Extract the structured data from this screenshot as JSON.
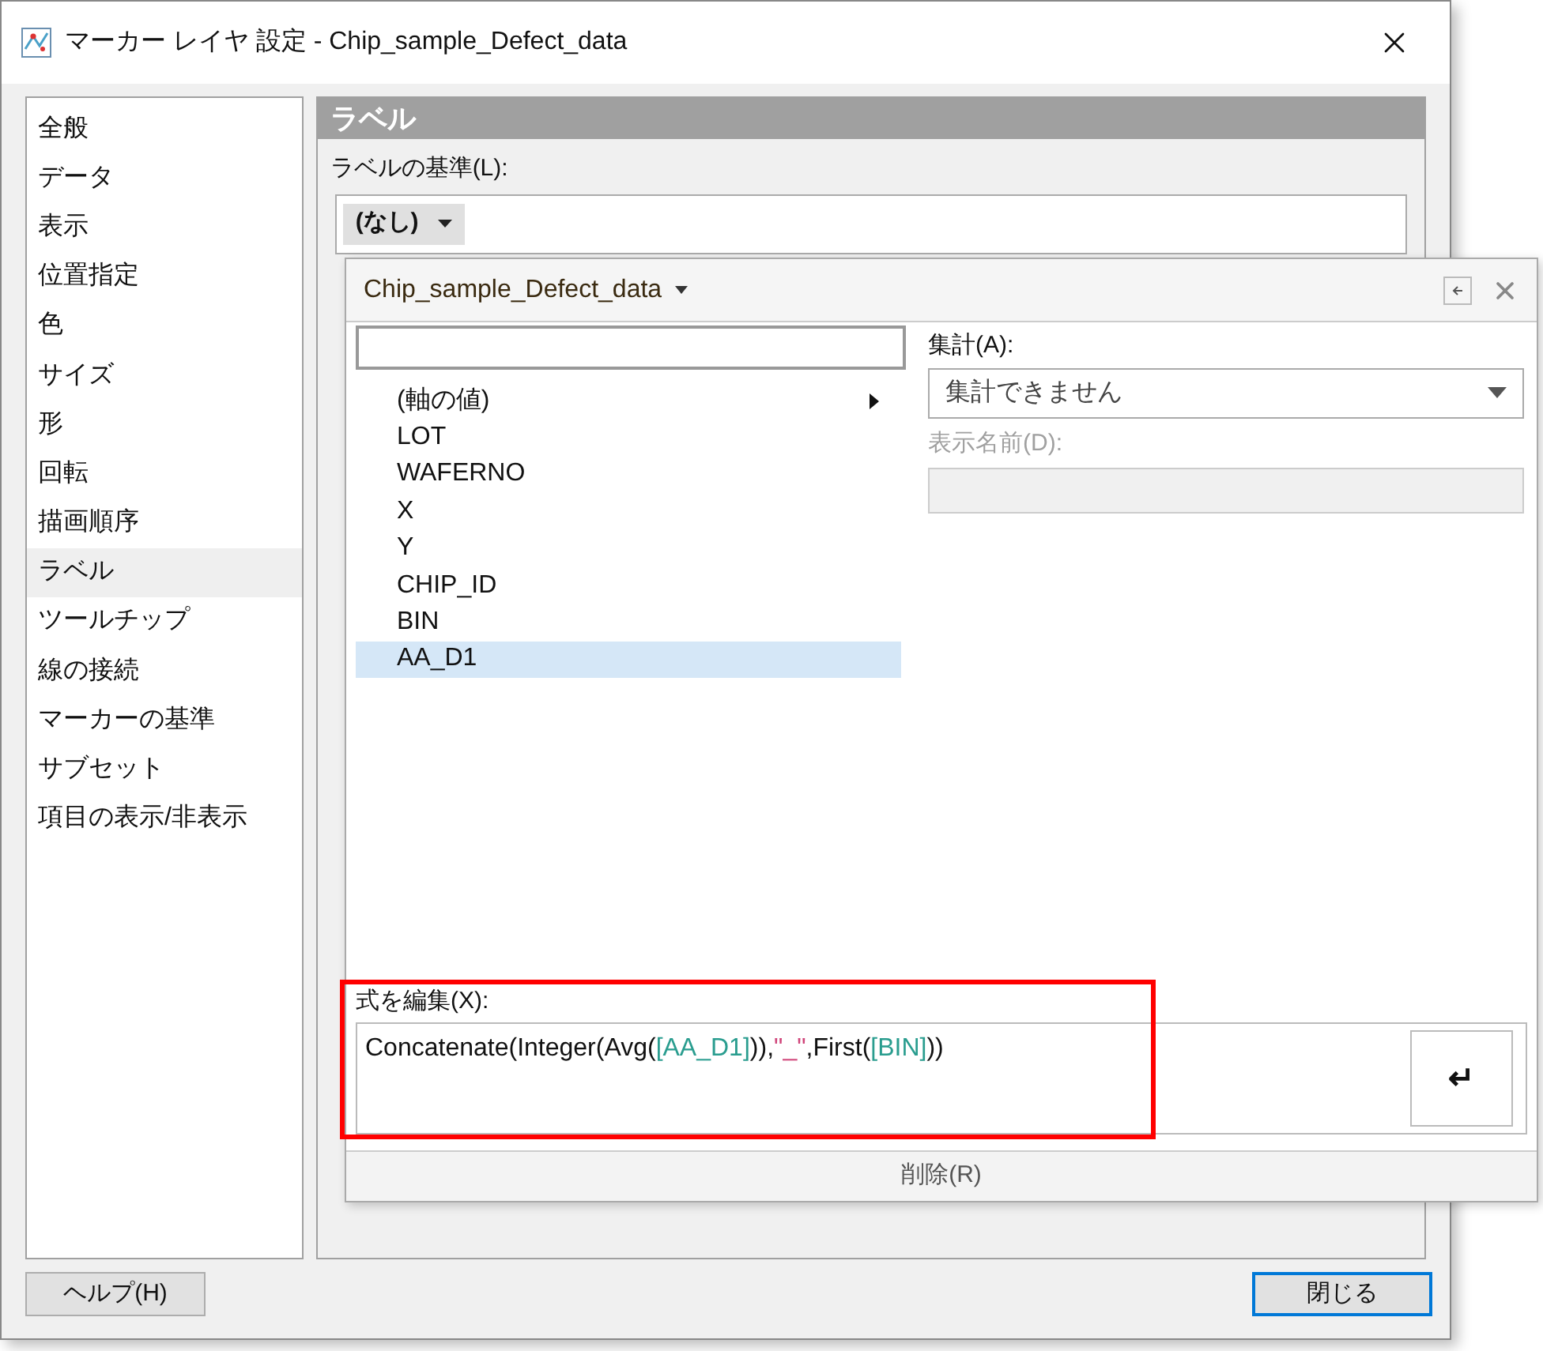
{
  "window": {
    "title": "マーカー レイヤ 設定 - Chip_sample_Defect_data"
  },
  "sidebar": {
    "items": [
      {
        "label": "全般",
        "selected": false
      },
      {
        "label": "データ",
        "selected": false
      },
      {
        "label": "表示",
        "selected": false
      },
      {
        "label": "位置指定",
        "selected": false
      },
      {
        "label": "色",
        "selected": false
      },
      {
        "label": "サイズ",
        "selected": false
      },
      {
        "label": "形",
        "selected": false
      },
      {
        "label": "回転",
        "selected": false
      },
      {
        "label": "描画順序",
        "selected": false
      },
      {
        "label": "ラベル",
        "selected": true
      },
      {
        "label": "ツールチップ",
        "selected": false
      },
      {
        "label": "線の接続",
        "selected": false
      },
      {
        "label": "マーカーの基準",
        "selected": false
      },
      {
        "label": "サブセット",
        "selected": false
      },
      {
        "label": "項目の表示/非表示",
        "selected": false
      }
    ]
  },
  "panel": {
    "header": "ラベル",
    "label_basis": {
      "label": "ラベルの基準(L):",
      "value": "(なし)"
    }
  },
  "popup": {
    "title": "Chip_sample_Defect_data",
    "columns": [
      {
        "label": "(軸の値)",
        "has_submenu": true,
        "selected": false
      },
      {
        "label": "LOT",
        "has_submenu": false,
        "selected": false
      },
      {
        "label": "WAFERNO",
        "has_submenu": false,
        "selected": false
      },
      {
        "label": "X",
        "has_submenu": false,
        "selected": false
      },
      {
        "label": "Y",
        "has_submenu": false,
        "selected": false
      },
      {
        "label": "CHIP_ID",
        "has_submenu": false,
        "selected": false
      },
      {
        "label": "BIN",
        "has_submenu": false,
        "selected": false
      },
      {
        "label": "AA_D1",
        "has_submenu": false,
        "selected": true
      }
    ],
    "aggregation": {
      "label": "集計(A):",
      "value": "集計できません"
    },
    "display_name": {
      "label": "表示名前(D):",
      "disabled": true
    },
    "expression": {
      "label": "式を編集(X):",
      "segments": [
        {
          "kind": "plain",
          "text": "Concatenate(Integer(Avg("
        },
        {
          "kind": "column",
          "text": "[AA_D1]"
        },
        {
          "kind": "plain",
          "text": ")),"
        },
        {
          "kind": "string",
          "text": "\"_\""
        },
        {
          "kind": "plain",
          "text": ",First("
        },
        {
          "kind": "column",
          "text": "[BIN]"
        },
        {
          "kind": "plain",
          "text": "))"
        }
      ],
      "enter_key": "↵"
    },
    "delete_button": "削除(R)"
  },
  "buttons": {
    "help": "ヘルプ(H)",
    "close": "閉じる"
  }
}
